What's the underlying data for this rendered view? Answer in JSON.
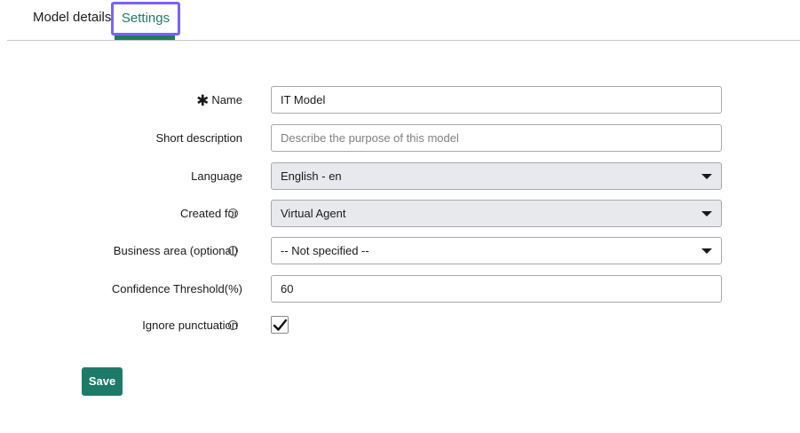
{
  "tabs": [
    {
      "label": "Model details",
      "active": false
    },
    {
      "label": "Settings",
      "active": true
    }
  ],
  "form": {
    "name": {
      "label": "Name",
      "value": "IT Model",
      "required": true
    },
    "short_description": {
      "label": "Short description",
      "value": "",
      "placeholder": "Describe the purpose of this model"
    },
    "language": {
      "label": "Language",
      "value": "English - en"
    },
    "created_for": {
      "label": "Created for",
      "value": "Virtual Agent"
    },
    "business_area": {
      "label": "Business area (optional)",
      "value": "-- Not specified --"
    },
    "confidence_threshold": {
      "label": "Confidence Threshold(%)",
      "value": "60"
    },
    "ignore_punctuation": {
      "label": "Ignore punctuation",
      "checked": true
    }
  },
  "save_label": "Save",
  "colors": {
    "accent": "#1e7a68",
    "focus_ring": "#7b61ff",
    "select_bg": "#e8e9ec"
  },
  "icons": {
    "required": "asterisk-icon",
    "info": "info-icon",
    "dropdown": "chevron-down-icon",
    "check": "checkmark-icon"
  }
}
